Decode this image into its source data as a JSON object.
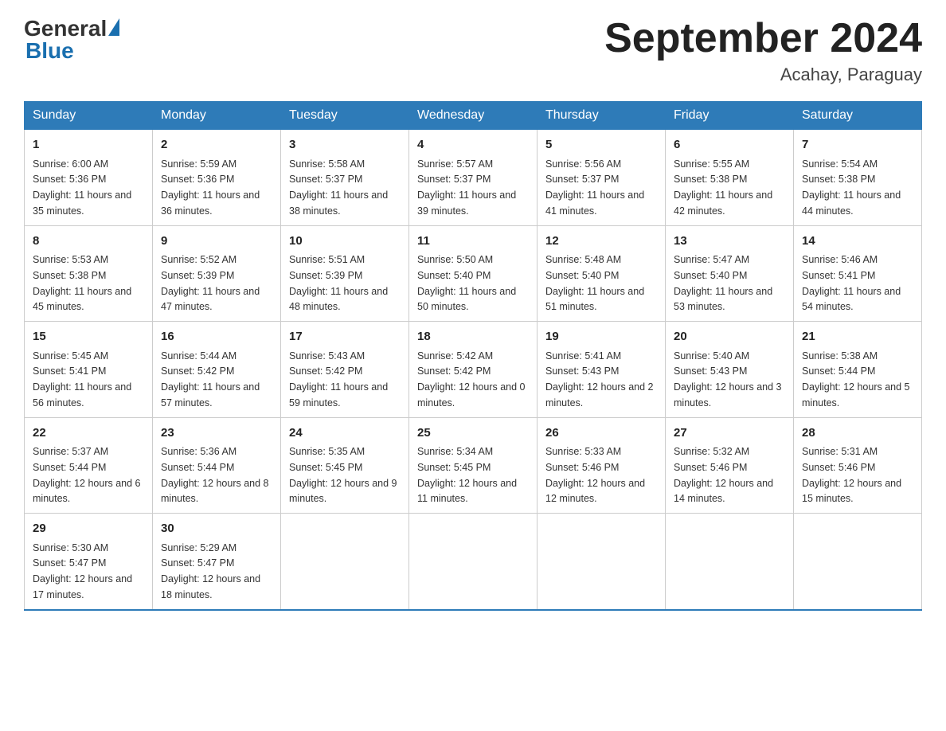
{
  "header": {
    "logo_general": "General",
    "logo_blue": "Blue",
    "title": "September 2024",
    "subtitle": "Acahay, Paraguay"
  },
  "days_of_week": [
    "Sunday",
    "Monday",
    "Tuesday",
    "Wednesday",
    "Thursday",
    "Friday",
    "Saturday"
  ],
  "weeks": [
    [
      {
        "day": "1",
        "sunrise": "6:00 AM",
        "sunset": "5:36 PM",
        "daylight": "11 hours and 35 minutes."
      },
      {
        "day": "2",
        "sunrise": "5:59 AM",
        "sunset": "5:36 PM",
        "daylight": "11 hours and 36 minutes."
      },
      {
        "day": "3",
        "sunrise": "5:58 AM",
        "sunset": "5:37 PM",
        "daylight": "11 hours and 38 minutes."
      },
      {
        "day": "4",
        "sunrise": "5:57 AM",
        "sunset": "5:37 PM",
        "daylight": "11 hours and 39 minutes."
      },
      {
        "day": "5",
        "sunrise": "5:56 AM",
        "sunset": "5:37 PM",
        "daylight": "11 hours and 41 minutes."
      },
      {
        "day": "6",
        "sunrise": "5:55 AM",
        "sunset": "5:38 PM",
        "daylight": "11 hours and 42 minutes."
      },
      {
        "day": "7",
        "sunrise": "5:54 AM",
        "sunset": "5:38 PM",
        "daylight": "11 hours and 44 minutes."
      }
    ],
    [
      {
        "day": "8",
        "sunrise": "5:53 AM",
        "sunset": "5:38 PM",
        "daylight": "11 hours and 45 minutes."
      },
      {
        "day": "9",
        "sunrise": "5:52 AM",
        "sunset": "5:39 PM",
        "daylight": "11 hours and 47 minutes."
      },
      {
        "day": "10",
        "sunrise": "5:51 AM",
        "sunset": "5:39 PM",
        "daylight": "11 hours and 48 minutes."
      },
      {
        "day": "11",
        "sunrise": "5:50 AM",
        "sunset": "5:40 PM",
        "daylight": "11 hours and 50 minutes."
      },
      {
        "day": "12",
        "sunrise": "5:48 AM",
        "sunset": "5:40 PM",
        "daylight": "11 hours and 51 minutes."
      },
      {
        "day": "13",
        "sunrise": "5:47 AM",
        "sunset": "5:40 PM",
        "daylight": "11 hours and 53 minutes."
      },
      {
        "day": "14",
        "sunrise": "5:46 AM",
        "sunset": "5:41 PM",
        "daylight": "11 hours and 54 minutes."
      }
    ],
    [
      {
        "day": "15",
        "sunrise": "5:45 AM",
        "sunset": "5:41 PM",
        "daylight": "11 hours and 56 minutes."
      },
      {
        "day": "16",
        "sunrise": "5:44 AM",
        "sunset": "5:42 PM",
        "daylight": "11 hours and 57 minutes."
      },
      {
        "day": "17",
        "sunrise": "5:43 AM",
        "sunset": "5:42 PM",
        "daylight": "11 hours and 59 minutes."
      },
      {
        "day": "18",
        "sunrise": "5:42 AM",
        "sunset": "5:42 PM",
        "daylight": "12 hours and 0 minutes."
      },
      {
        "day": "19",
        "sunrise": "5:41 AM",
        "sunset": "5:43 PM",
        "daylight": "12 hours and 2 minutes."
      },
      {
        "day": "20",
        "sunrise": "5:40 AM",
        "sunset": "5:43 PM",
        "daylight": "12 hours and 3 minutes."
      },
      {
        "day": "21",
        "sunrise": "5:38 AM",
        "sunset": "5:44 PM",
        "daylight": "12 hours and 5 minutes."
      }
    ],
    [
      {
        "day": "22",
        "sunrise": "5:37 AM",
        "sunset": "5:44 PM",
        "daylight": "12 hours and 6 minutes."
      },
      {
        "day": "23",
        "sunrise": "5:36 AM",
        "sunset": "5:44 PM",
        "daylight": "12 hours and 8 minutes."
      },
      {
        "day": "24",
        "sunrise": "5:35 AM",
        "sunset": "5:45 PM",
        "daylight": "12 hours and 9 minutes."
      },
      {
        "day": "25",
        "sunrise": "5:34 AM",
        "sunset": "5:45 PM",
        "daylight": "12 hours and 11 minutes."
      },
      {
        "day": "26",
        "sunrise": "5:33 AM",
        "sunset": "5:46 PM",
        "daylight": "12 hours and 12 minutes."
      },
      {
        "day": "27",
        "sunrise": "5:32 AM",
        "sunset": "5:46 PM",
        "daylight": "12 hours and 14 minutes."
      },
      {
        "day": "28",
        "sunrise": "5:31 AM",
        "sunset": "5:46 PM",
        "daylight": "12 hours and 15 minutes."
      }
    ],
    [
      {
        "day": "29",
        "sunrise": "5:30 AM",
        "sunset": "5:47 PM",
        "daylight": "12 hours and 17 minutes."
      },
      {
        "day": "30",
        "sunrise": "5:29 AM",
        "sunset": "5:47 PM",
        "daylight": "12 hours and 18 minutes."
      },
      {
        "day": "",
        "sunrise": "",
        "sunset": "",
        "daylight": ""
      },
      {
        "day": "",
        "sunrise": "",
        "sunset": "",
        "daylight": ""
      },
      {
        "day": "",
        "sunrise": "",
        "sunset": "",
        "daylight": ""
      },
      {
        "day": "",
        "sunrise": "",
        "sunset": "",
        "daylight": ""
      },
      {
        "day": "",
        "sunrise": "",
        "sunset": "",
        "daylight": ""
      }
    ]
  ],
  "labels": {
    "sunrise": "Sunrise:",
    "sunset": "Sunset:",
    "daylight": "Daylight:"
  }
}
